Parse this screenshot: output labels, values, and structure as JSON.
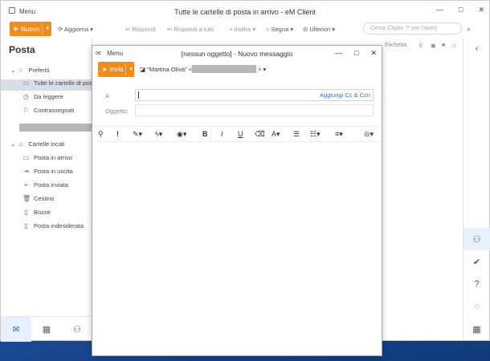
{
  "main": {
    "menu_label": "Menu",
    "title": "Tutte le cartelle di posta in arrivo - eM Client",
    "win_min": "—",
    "win_max": "□",
    "win_close": "✕",
    "new_label": "Nuovo",
    "toolbar": {
      "aggiorna": "Aggiorna",
      "rispondi": "Rispondi",
      "rispondi_tutti": "Rispondi a tutti",
      "inoltra": "Inoltra",
      "segna": "Segna",
      "ulteriori": "Ulteriori"
    },
    "search_placeholder": "Cerca (Digita '?' per l'aiuto)",
    "list_header_label": "Etichetta"
  },
  "sidebar": {
    "title": "Posta",
    "preferiti": "Preferiti",
    "items_fav": [
      "Tutte le cartelle di posta",
      "Da leggere",
      "Contrassegnati"
    ],
    "cartelle_locali": "Cartelle locali",
    "items_local": [
      "Posta in arrivo",
      "Posta in uscita",
      "Posta inviata",
      "Cestino",
      "Bozze",
      "Posta indesiderata"
    ]
  },
  "compose": {
    "menu_label": "Menu",
    "title": "[nessun oggetto] - Nuovo messaggio",
    "win_min": "—",
    "win_max": "□",
    "win_close": "✕",
    "send_label": "Invia",
    "from_name": "\"Martina Oliva\" <",
    "from_tail": ">",
    "to_label": "A:",
    "cc_label": "Aggiungi Cc & Ccn",
    "subject_label": "Oggetto:"
  },
  "colors": {
    "accent": "#f08c1e",
    "link": "#3b6fc7",
    "desktop": "#1e4f9c"
  }
}
